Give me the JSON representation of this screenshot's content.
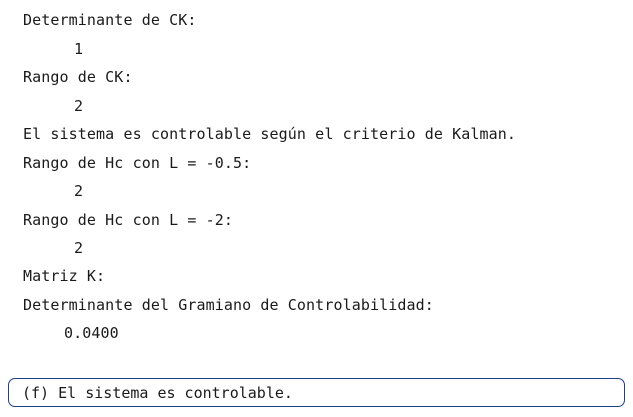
{
  "console": {
    "lines": [
      "Determinante de CK:",
      "1",
      "Rango de CK:",
      "2",
      "El sistema es controlable según el criterio de Kalman.",
      "Rango de Hc con L = -0.5:",
      "2",
      "Rango de Hc con L = -2:",
      "2",
      "Matriz K:",
      "Determinante del Gramiano de Controlabilidad:",
      "0.0400"
    ]
  },
  "command_line": {
    "text": "(f) El sistema es controlable."
  }
}
